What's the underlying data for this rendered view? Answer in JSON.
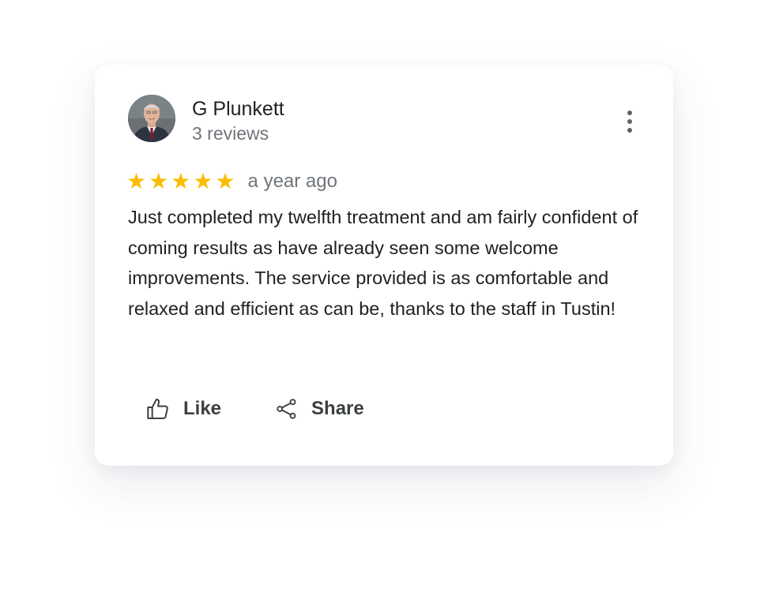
{
  "review": {
    "reviewer_name": "G Plunkett",
    "review_count": "3 reviews",
    "rating": 5,
    "rating_max": 5,
    "stars": [
      "★",
      "★",
      "★",
      "★",
      "★"
    ],
    "date": "a year ago",
    "text": "Just completed my twelfth treatment and am fairly confident of coming results as have already seen some welcome improvements.  The service provided is as comfortable and relaxed and efficient as can be, thanks to the staff in Tustin!",
    "star_color": "#fbbc04",
    "icons": {
      "avatar": "reviewer-photo",
      "more": "more-vert-icon",
      "like": "thumb-up-icon",
      "share": "share-icon"
    }
  },
  "actions": {
    "like_label": "Like",
    "share_label": "Share"
  }
}
